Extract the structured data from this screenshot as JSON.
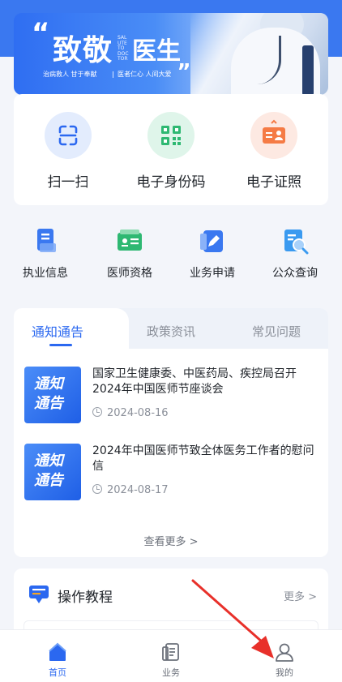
{
  "banner": {
    "quote_open": "“",
    "title_a": "致敬",
    "title_vertical": "SALUTE TO DOCTOR",
    "title_b": "医生",
    "quote_close": "„",
    "slogan_a": "治病救人 甘于奉献",
    "slogan_b": "医者仁心 人间大爱"
  },
  "quick_actions": [
    {
      "label": "扫一扫",
      "icon": "scan-icon"
    },
    {
      "label": "电子身份码",
      "icon": "qr-code-icon"
    },
    {
      "label": "电子证照",
      "icon": "id-card-icon"
    }
  ],
  "nav_items": [
    {
      "label": "执业信息",
      "icon": "document-icon"
    },
    {
      "label": "医师资格",
      "icon": "certificate-icon"
    },
    {
      "label": "业务申请",
      "icon": "edit-icon"
    },
    {
      "label": "公众查询",
      "icon": "search-document-icon"
    }
  ],
  "notice": {
    "tabs": [
      "通知通告",
      "政策资讯",
      "常见问题"
    ],
    "active_tab": 0,
    "thumb_text": "通知\n通告",
    "items": [
      {
        "title": "国家卫生健康委、中医药局、疾控局召开2024年中国医师节座谈会",
        "date": "2024-08-16"
      },
      {
        "title": "2024年中国医师节致全体医务工作者的慰问信",
        "date": "2024-08-17"
      }
    ],
    "more": "查看更多 >"
  },
  "tutorial": {
    "title": "操作教程",
    "more": "更多 >"
  },
  "tabbar": [
    {
      "label": "首页",
      "icon": "home-icon",
      "active": true
    },
    {
      "label": "业务",
      "icon": "business-icon",
      "active": false
    },
    {
      "label": "我的",
      "icon": "user-icon",
      "active": false
    }
  ],
  "colors": {
    "primary": "#2b68f0",
    "annotation_arrow": "#e8302a"
  }
}
